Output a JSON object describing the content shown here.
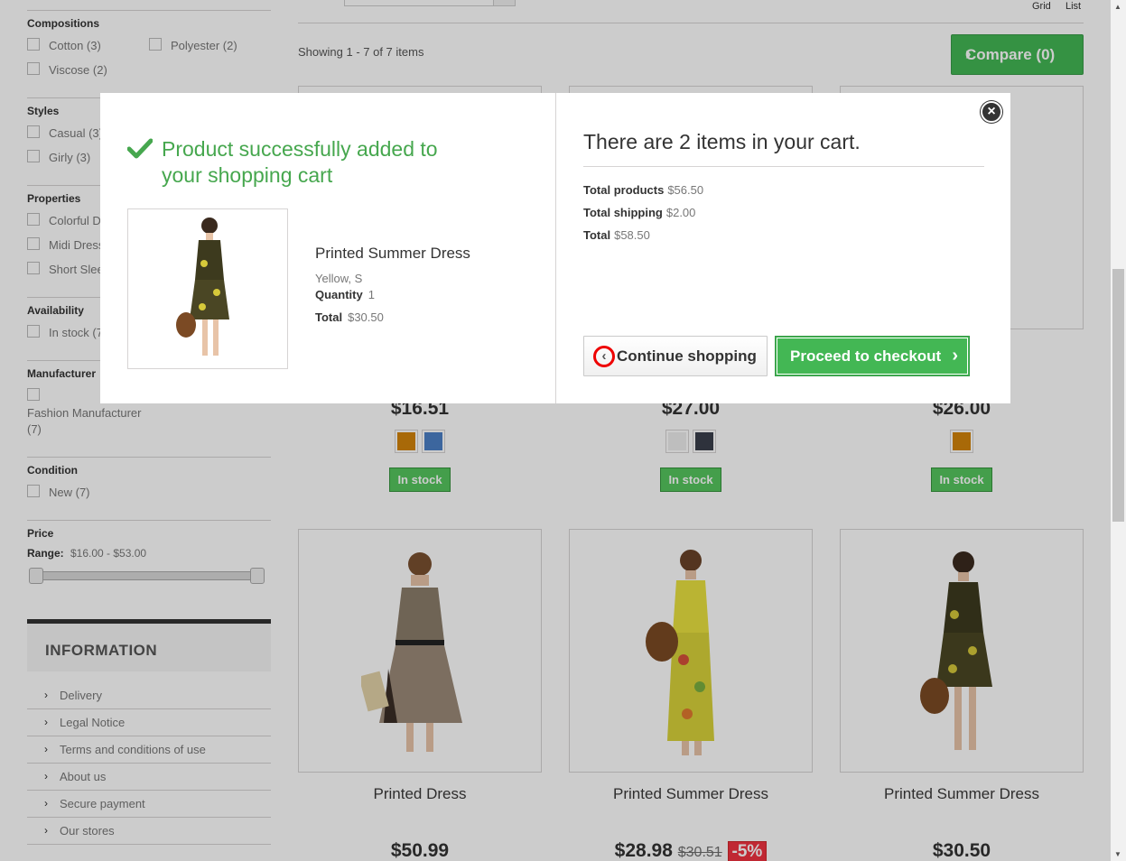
{
  "filters": {
    "compositions": {
      "title": "Compositions",
      "options": [
        "Cotton (3)",
        "Polyester (2)",
        "Viscose (2)"
      ]
    },
    "styles": {
      "title": "Styles",
      "options": [
        "Casual (3)",
        "Girly (3)"
      ]
    },
    "properties": {
      "title": "Properties",
      "options": [
        "Colorful Dress (3)",
        "Midi Dress (2)",
        "Short Sleeve (2)"
      ]
    },
    "availability": {
      "title": "Availability",
      "options": [
        "In stock (7)"
      ]
    },
    "manufacturer": {
      "title": "Manufacturer",
      "options": [
        "Fashion Manufacturer",
        "(7)"
      ]
    },
    "condition": {
      "title": "Condition",
      "options": [
        "New (7)"
      ]
    },
    "price": {
      "title": "Price",
      "range_label": "Range:",
      "range_value": "$16.00 - $53.00"
    }
  },
  "information": {
    "title": "INFORMATION",
    "items": [
      "Delivery",
      "Legal Notice",
      "Terms and conditions of use",
      "About us",
      "Secure payment",
      "Our stores"
    ]
  },
  "toolbar": {
    "view_grid": "Grid",
    "view_list": "List",
    "showing": "Showing 1 - 7 of 7 items",
    "compare_label": "Compare (0)"
  },
  "products_row1": [
    {
      "price": "$16.51",
      "swatches": [
        "#d2840b",
        "#4b80c6"
      ],
      "stock": "In stock"
    },
    {
      "price": "$27.00",
      "swatches": [
        "#eeeeee",
        "#3a3f4c"
      ],
      "stock": "In stock"
    },
    {
      "price": "$26.00",
      "swatches": [
        "#d2840b"
      ],
      "stock": "In stock"
    }
  ],
  "products_row2": [
    {
      "name": "Printed Dress",
      "price": "$50.99"
    },
    {
      "name": "Printed Summer Dress",
      "price": "$28.98",
      "old_price": "$30.51",
      "discount": "-5%"
    },
    {
      "name": "Printed Summer Dress",
      "price": "$30.50"
    }
  ],
  "modal": {
    "success_text": "Product successfully added to your shopping cart",
    "product_name": "Printed Summer Dress",
    "product_attributes": "Yellow, S",
    "quantity_label": "Quantity",
    "quantity_value": "1",
    "total_label": "Total",
    "total_value": "$30.50",
    "cart_title": "There are 2 items in your cart.",
    "total_products_label": "Total products",
    "total_products_value": "$56.50",
    "total_shipping_label": "Total shipping",
    "total_shipping_value": "$2.00",
    "cart_total_label": "Total",
    "cart_total_value": "$58.50",
    "continue_label": "Continue shopping",
    "checkout_label": "Proceed to checkout"
  },
  "colors": {
    "accent_green": "#43b754",
    "success_green": "#46a74e",
    "stock_green": "#55c65e",
    "discount_red": "#f13340",
    "highlight_red": "#ee0000"
  },
  "icons": [
    "check-icon",
    "close-icon",
    "chevron-left-icon",
    "chevron-right-icon"
  ]
}
